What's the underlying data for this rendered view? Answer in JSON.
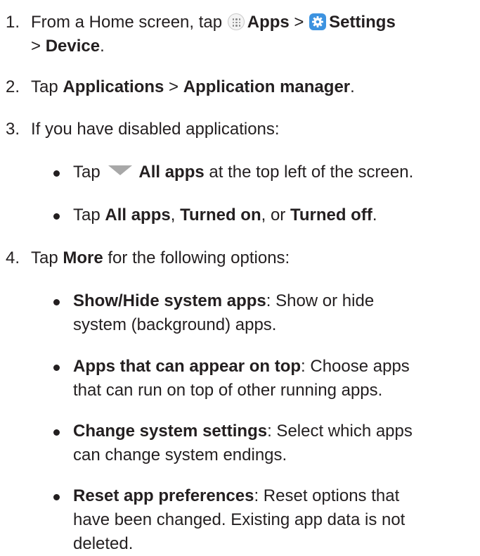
{
  "steps": [
    {
      "num": "1.",
      "t1": "From a Home screen, tap ",
      "apps": "Apps",
      "gt1": " > ",
      "settings": "Settings",
      "gt2": "> ",
      "device": "Device",
      "end": "."
    },
    {
      "num": "2.",
      "t1": "Tap ",
      "b1": "Applications",
      "gt": " > ",
      "b2": "Application manager",
      "end": "."
    },
    {
      "num": "3.",
      "text": "If you have disabled applications:"
    },
    {
      "num": "4.",
      "t1": "Tap ",
      "b1": "More",
      "t2": " for the following options:"
    }
  ],
  "sub3": [
    {
      "t1": "Tap ",
      "b1": "All apps",
      "t2": " at the top left of the screen."
    },
    {
      "t1": "Tap ",
      "b1": "All apps",
      "s1": ", ",
      "b2": "Turned on",
      "s2": ", or ",
      "b3": "Turned off",
      "end": "."
    }
  ],
  "sub4": [
    {
      "b": "Show/Hide system apps",
      "l1": ": Show or hide",
      "l2": "system (background) apps."
    },
    {
      "b": "Apps that can appear on top",
      "l1": ": Choose apps",
      "l2": "that can run on top of other running apps."
    },
    {
      "b": "Change system settings",
      "l1": ": Select which apps",
      "l2": "can change system endings."
    },
    {
      "b": "Reset app preferences",
      "l1": ": Reset options that",
      "l2": "have been changed. Existing app data is not",
      "l3": "deleted."
    }
  ],
  "icons": {
    "apps": "apps-grid-icon",
    "settings": "settings-gear-icon",
    "dropdown": "dropdown-triangle-icon"
  },
  "colors": {
    "text": "#231f20",
    "settings_icon": "#3d93e0",
    "triangle": "#a8a8a8"
  }
}
